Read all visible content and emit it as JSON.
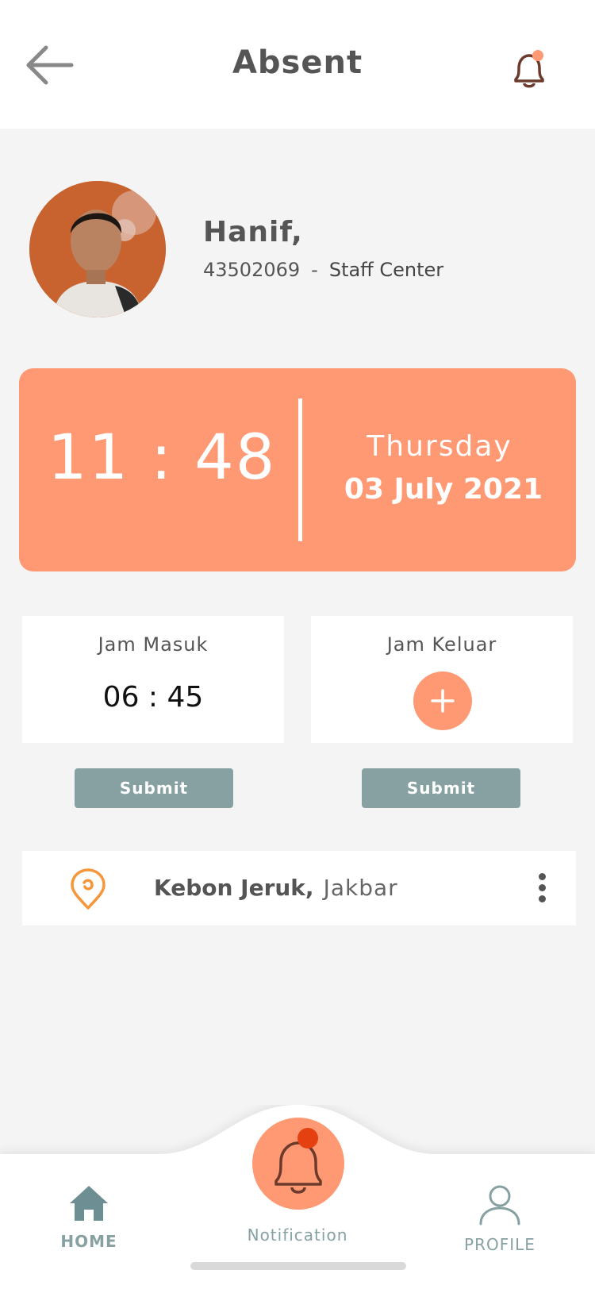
{
  "header": {
    "title": "Absent",
    "back_icon": "arrow-left-icon",
    "notification_icon": "bell-icon"
  },
  "user": {
    "name": "Hanif,",
    "id": "43502069",
    "separator": "-",
    "role": "Staff Center",
    "avatar": "avatar-photo"
  },
  "clock": {
    "time": "11 : 48",
    "day": "Thursday",
    "date": "03 July 2021"
  },
  "attendance": {
    "in_label": "Jam Masuk",
    "in_value": "06 : 45",
    "out_label": "Jam Keluar",
    "out_action_icon": "plus-icon",
    "submit_label": "Submit"
  },
  "location": {
    "city": "Kebon Jeruk,",
    "region": "Jakbar",
    "icon": "map-pin-icon",
    "menu_icon": "kebab-menu-icon"
  },
  "nav": {
    "home_label": "HOME",
    "notification_label": "Notification",
    "profile_label": "PROFILE"
  },
  "colors": {
    "accent": "#ff9973",
    "muted_teal": "#87a1a3",
    "badge": "#e5400f",
    "pin": "#f5963a",
    "background": "#f4f4f4"
  }
}
